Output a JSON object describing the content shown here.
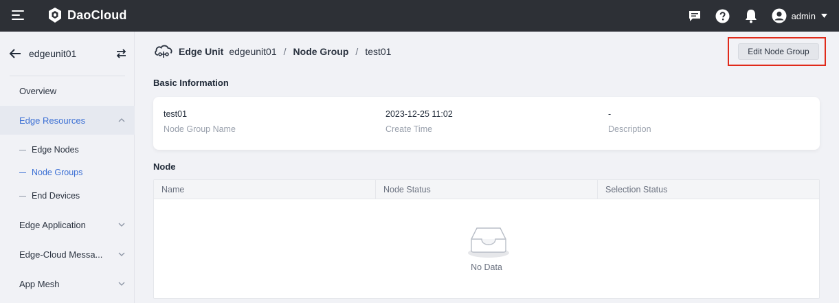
{
  "topbar": {
    "brand": "DaoCloud",
    "user_name": "admin",
    "icons": [
      "menu-icon",
      "chat-icon",
      "help-icon",
      "bell-icon",
      "user-avatar-icon",
      "caret-down-icon"
    ]
  },
  "sidebar": {
    "unit_name": "edgeunit01",
    "items": [
      {
        "label": "Overview"
      },
      {
        "label": "Edge Resources"
      },
      {
        "label": "Edge Application"
      },
      {
        "label": "Edge-Cloud Messa..."
      },
      {
        "label": "App Mesh"
      }
    ],
    "sub_items": [
      {
        "label": "Edge Nodes"
      },
      {
        "label": "Node Groups"
      },
      {
        "label": "End Devices"
      }
    ]
  },
  "breadcrumb": {
    "section": "Edge Unit",
    "unit": "edgeunit01",
    "sep": "/",
    "group_section": "Node Group",
    "current": "test01"
  },
  "actions": {
    "edit_label": "Edit Node Group"
  },
  "basic_info": {
    "title": "Basic Information",
    "fields": [
      {
        "value": "test01",
        "label": "Node Group Name"
      },
      {
        "value": "2023-12-25 11:02",
        "label": "Create Time"
      },
      {
        "value": "-",
        "label": "Description"
      }
    ]
  },
  "node_table": {
    "title": "Node",
    "columns": [
      "Name",
      "Node Status",
      "Selection Status"
    ],
    "empty_text": "No Data"
  },
  "colors": {
    "topbar_bg": "#2d3036",
    "accent": "#3b6fd4",
    "highlight": "#e02a1a"
  }
}
